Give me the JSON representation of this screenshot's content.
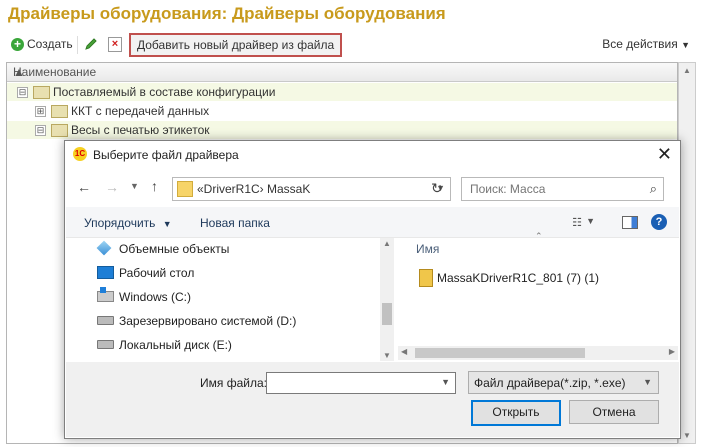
{
  "form": {
    "title": "Драйверы оборудования: Драйверы оборудования",
    "toolbar": {
      "create_label": "Создать",
      "add_from_file_label": "Добавить новый драйвер из файла",
      "all_actions_label": "Все действия"
    },
    "grid": {
      "column_name": "Наименование",
      "rows": [
        {
          "label": "Поставляемый в составе конфигурации",
          "toggle": "⊟"
        },
        {
          "label": "ККТ с передачей данных",
          "toggle": "⊞"
        },
        {
          "label": "Весы с печатью этикеток",
          "toggle": "⊟"
        }
      ]
    }
  },
  "dialog": {
    "title": "Выберите файл драйвера",
    "path_text": "«DriverR1C›  MassaK",
    "search_placeholder": "Поиск: Масса",
    "commands": {
      "organize_label": "Упорядочить",
      "new_folder_label": "Новая папка"
    },
    "nav_tree": [
      {
        "label": "Объемные объекты",
        "icon": "3d-objects-icon"
      },
      {
        "label": "Рабочий стол",
        "icon": "desktop-icon"
      },
      {
        "label": "Windows (C:)",
        "icon": "windows-drive-icon"
      },
      {
        "label": "Зарезервировано системой (D:)",
        "icon": "drive-icon"
      },
      {
        "label": "Локальный диск (E:)",
        "icon": "drive-icon"
      }
    ],
    "file_list": {
      "column_name": "Имя",
      "files": [
        {
          "name": "MassaKDriverR1C_801 (7) (1)",
          "icon": "zip-folder-icon"
        }
      ]
    },
    "filename_label": "Имя файла:",
    "filename_value": "",
    "filter_label": "Файл драйвера(*.zip, *.exe)",
    "open_label": "Открыть",
    "cancel_label": "Отмена"
  }
}
